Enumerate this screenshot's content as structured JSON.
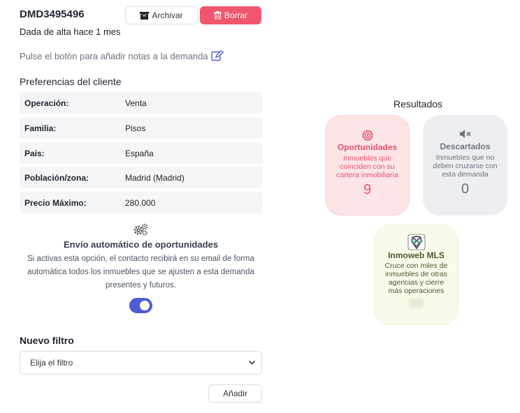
{
  "header": {
    "demand_id": "DMD3495496",
    "created": "Dada de alta hace 1 mes",
    "archive_label": "Archivar",
    "delete_label": "Borrar"
  },
  "notes": {
    "text": "Pulse el botón para añadir notas a la demanda",
    "icon": "edit-icon"
  },
  "preferences": {
    "title": "Preferencias del cliente",
    "rows": [
      {
        "key": "Operación:",
        "value": "Venta"
      },
      {
        "key": "Familia:",
        "value": "Pisos"
      },
      {
        "key": "País:",
        "value": "España"
      },
      {
        "key": "Población/zona:",
        "value": "Madrid (Madrid)"
      },
      {
        "key": "Precio Máximo:",
        "value": "280.000"
      }
    ]
  },
  "auto_send": {
    "title": "Envío automático de oportunidades",
    "description": "Si activas esta opción, el contacto recibirá en su email de forma automática todos los inmuebles que se ajusten a esta demanda presentes y futuros.",
    "enabled": true,
    "toggle_color": "#4f5bd5"
  },
  "filter": {
    "title": "Nuevo filtro",
    "selected": "Elija el filtro",
    "add_label": "Añadir"
  },
  "results": {
    "title": "Resultados",
    "opportunities": {
      "title": "Oportunidades",
      "description": "Inmuebles que coinciden con su cartera inmobiliaria",
      "count": "9",
      "color": "#e9546b"
    },
    "discarded": {
      "title": "Descartados",
      "description": "Inmuebles que no deben cruzarse con esta demanda",
      "count": "0"
    },
    "mls": {
      "title": "Inmoweb MLS",
      "description": "Cruce con miles de inmuebles de otras agencias y cierre más operaciones",
      "count": "99"
    }
  },
  "colors": {
    "delete": "#f0576e",
    "accent": "#4f5bd5"
  }
}
